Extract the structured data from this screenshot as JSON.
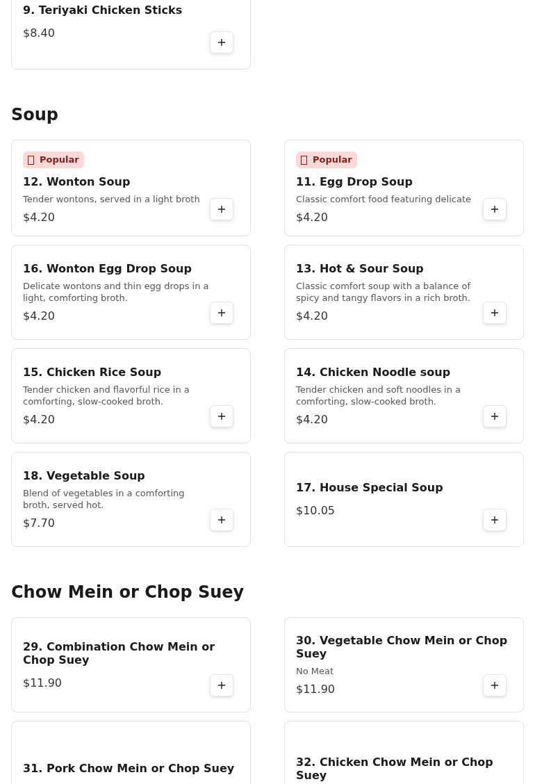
{
  "sections": [
    {
      "items": [
        {
          "name": "9. Teriyaki Chicken Sticks",
          "price": "$8.40"
        }
      ]
    },
    {
      "title": "Soup",
      "items": [
        {
          "badge": "Popular",
          "name": "12. Wonton Soup",
          "description": "Tender wontons, served in a light broth",
          "price": "$4.20"
        },
        {
          "badge": "Popular",
          "name": "11. Egg Drop Soup",
          "description": "Classic comfort food featuring delicate",
          "price": "$4.20"
        },
        {
          "name": "16. Wonton Egg Drop Soup",
          "description": "Delicate wontons and thin egg drops in a light, comforting broth.",
          "price": "$4.20"
        },
        {
          "name": "13. Hot & Sour Soup",
          "description": "Classic comfort soup with a balance of spicy and tangy flavors in a rich broth.",
          "price": "$4.20"
        },
        {
          "name": "15. Chicken Rice Soup",
          "description": "Tender chicken and flavorful rice in a comforting, slow-cooked broth.",
          "price": "$4.20"
        },
        {
          "name": "14. Chicken Noodle soup",
          "description": "Tender chicken and soft noodles in a comforting, slow-cooked broth.",
          "price": "$4.20"
        },
        {
          "name": "18. Vegetable Soup",
          "description": "Blend of vegetables in a comforting broth, served hot.",
          "price": "$7.70"
        },
        {
          "name": "17. House Special Soup",
          "price": "$10.05"
        }
      ]
    },
    {
      "title": "Chow Mein or Chop Suey",
      "items": [
        {
          "name": "29. Combination Chow Mein or Chop Suey",
          "price": "$11.90"
        },
        {
          "name": "30. Vegetable Chow Mein or Chop Suey",
          "description": "No Meat",
          "price": "$11.90"
        },
        {
          "name": "31. Pork Chow Mein or Chop Suey"
        },
        {
          "name": "32. Chicken Chow Mein or Chop Suey"
        }
      ]
    }
  ]
}
